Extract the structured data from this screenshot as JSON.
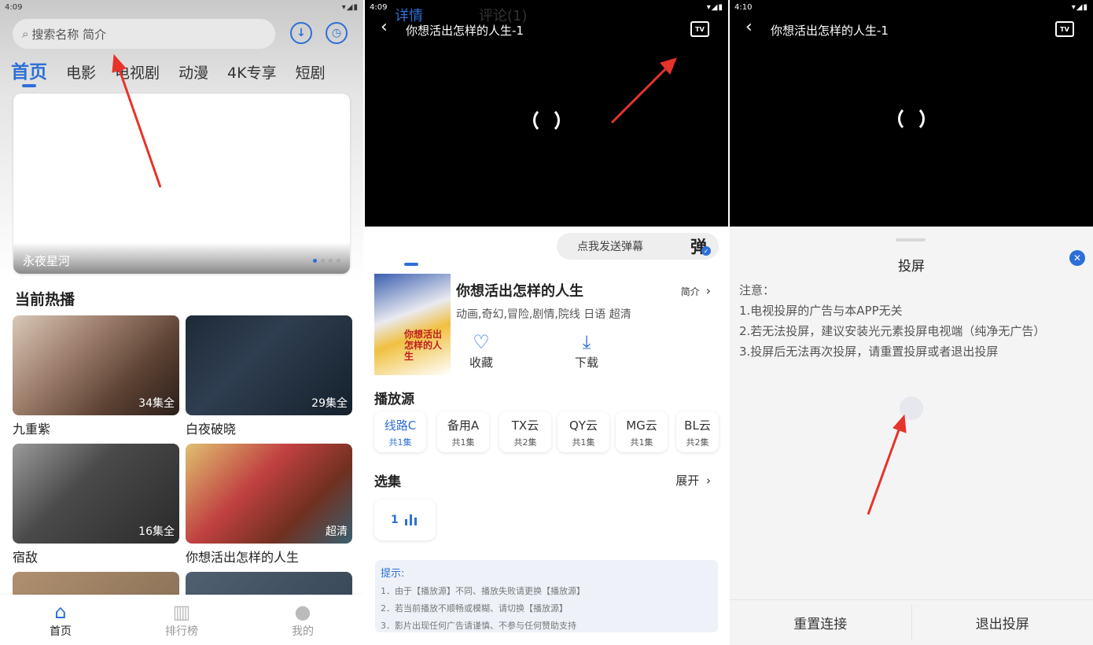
{
  "panel_home": {
    "status_time": "4:09",
    "status_icons": "▾◢▮",
    "search_placeholder": "搜索名称 简介",
    "categories": [
      "首页",
      "电影",
      "电视剧",
      "动漫",
      "4K专享",
      "短剧"
    ],
    "banner_caption": "永夜星河",
    "section_title": "当前热播",
    "cards": [
      {
        "title": "九重紫",
        "badge": "34集全"
      },
      {
        "title": "白夜破晓",
        "badge": "29集全"
      },
      {
        "title": "宿敌",
        "badge": "16集全"
      },
      {
        "title": "你想活出怎样的人生",
        "badge": "超清"
      }
    ],
    "nav": [
      {
        "label": "首页",
        "icon": "home-icon"
      },
      {
        "label": "排行榜",
        "icon": "ranking-icon"
      },
      {
        "label": "我的",
        "icon": "profile-icon"
      }
    ]
  },
  "panel_detail": {
    "status_time": "4:09",
    "player_title": "你想活出怎样的人生-1",
    "tabs": [
      "详情",
      "评论(1)"
    ],
    "danmu_placeholder": "点我发送弹幕",
    "danmu_icon_label": "弹",
    "poster_text": "你想活出怎样的人生",
    "movie_title": "你想活出怎样的人生",
    "brief_label": "简介",
    "tags": "动画,奇幻,冒险,剧情,院线 日语 超清",
    "collect_label": "收藏",
    "download_label": "下载",
    "source_heading": "播放源",
    "sources": [
      {
        "name": "线路C",
        "count": "共1集"
      },
      {
        "name": "备用A",
        "count": "共1集"
      },
      {
        "name": "TX云",
        "count": "共2集"
      },
      {
        "name": "QY云",
        "count": "共1集"
      },
      {
        "name": "MG云",
        "count": "共1集"
      },
      {
        "name": "BL云",
        "count": "共2集"
      }
    ],
    "episodes_heading": "选集",
    "expand_label": "展开",
    "episode_number": "1",
    "tips_title": "提示:",
    "tips": [
      "1．由于【播放源】不同、播放失败请更换【播放源】",
      "2．若当前播放不顺畅或模糊、请切换【播放源】",
      "3．影片出现任何广告请谨慎、不参与任何赞助支持"
    ]
  },
  "panel_cast": {
    "status_time": "4:10",
    "player_title": "你想活出怎样的人生-1",
    "sheet_title": "投屏",
    "notes": [
      "注意：",
      "1.电视投屏的广告与本APP无关",
      "2.若无法投屏，建议安装光元素投屏电视端（纯净无广告）",
      "3.投屏后无法再次投屏，请重置投屏或者退出投屏"
    ],
    "reset_label": "重置连接",
    "exit_label": "退出投屏"
  },
  "colors": {
    "accent": "#2d6fd6",
    "annotation_arrow": "#e8332a"
  }
}
